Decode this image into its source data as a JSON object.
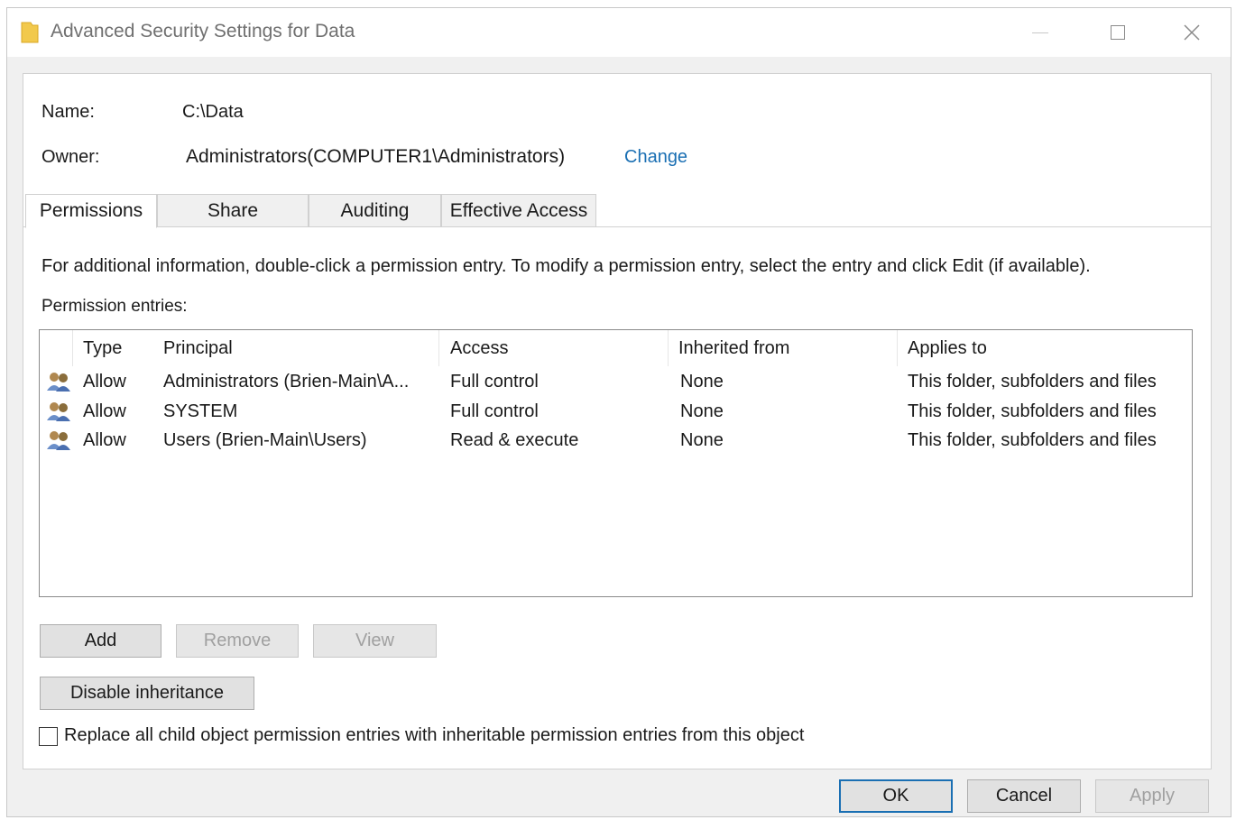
{
  "window": {
    "title": "Advanced Security Settings for Data"
  },
  "info": {
    "name_label": "Name:",
    "name_value": "C:\\Data",
    "owner_label": "Owner:",
    "owner_value": "Administrators(COMPUTER1\\Administrators)",
    "change_link": "Change"
  },
  "tabs": [
    {
      "label": "Permissions",
      "active": true
    },
    {
      "label": "Share",
      "active": false
    },
    {
      "label": "Auditing",
      "active": false
    },
    {
      "label": "Effective Access",
      "active": false
    }
  ],
  "instructions": "For additional information, double-click a permission entry. To modify a permission entry, select the entry and click Edit (if available).",
  "entries_label": "Permission entries:",
  "table": {
    "columns": [
      "Type",
      "Principal",
      "Access",
      "Inherited from",
      "Applies to"
    ],
    "rows": [
      {
        "type": "Allow",
        "principal": "Administrators (Brien-Main\\A...",
        "access": "Full control",
        "inherited": "None",
        "applies": "This folder, subfolders and files"
      },
      {
        "type": "Allow",
        "principal": "SYSTEM",
        "access": "Full control",
        "inherited": "None",
        "applies": "This folder, subfolders and files"
      },
      {
        "type": "Allow",
        "principal": "Users (Brien-Main\\Users)",
        "access": "Read & execute",
        "inherited": "None",
        "applies": "This folder, subfolders and files"
      }
    ]
  },
  "buttons": {
    "add": "Add",
    "remove": "Remove",
    "view": "View",
    "disable_inheritance": "Disable inheritance",
    "ok": "OK",
    "cancel": "Cancel",
    "apply": "Apply"
  },
  "replace_checkbox": {
    "label": "Replace all child object permission entries with inheritable permission entries from this object",
    "checked": false
  },
  "colors": {
    "link": "#1a6fb3",
    "folder": "#f2c94c",
    "user_icon": "#8a6d3b"
  }
}
